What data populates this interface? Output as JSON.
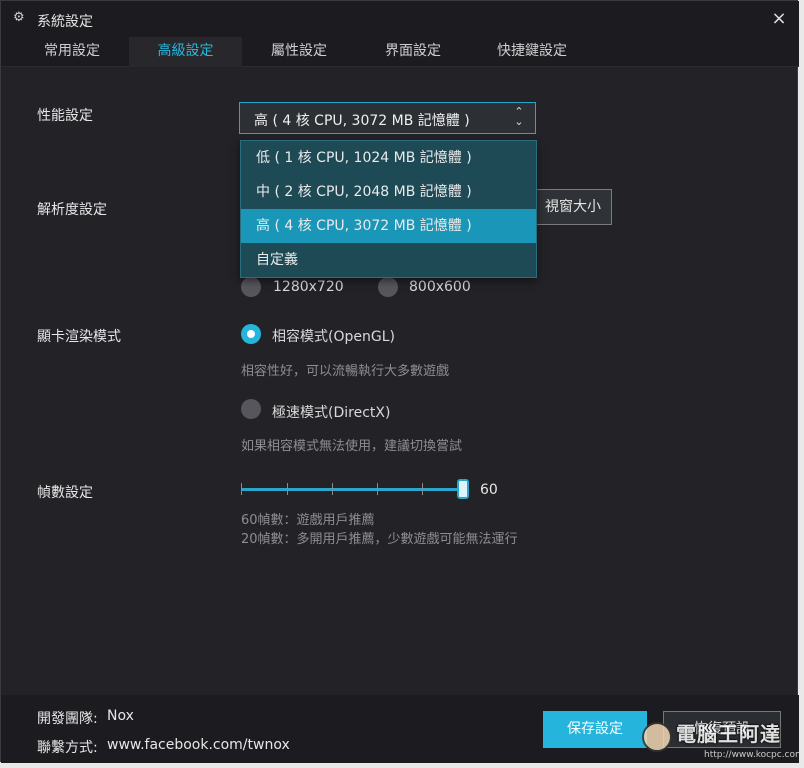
{
  "window": {
    "title": "系統設定",
    "close_glyph": "×",
    "settings_icon": "gear-icon"
  },
  "tabs": [
    {
      "label": "常用設定",
      "active": false
    },
    {
      "label": "高級設定",
      "active": true
    },
    {
      "label": "屬性設定",
      "active": false
    },
    {
      "label": "界面設定",
      "active": false
    },
    {
      "label": "快捷鍵設定",
      "active": false
    }
  ],
  "performance": {
    "label": "性能設定",
    "selected": "高 ( 4 核 CPU, 3072 MB 記憶體 )",
    "options": [
      "低 ( 1 核 CPU, 1024 MB 記憶體 )",
      "中 ( 2 核 CPU, 2048 MB 記憶體 )",
      "高 ( 4 核 CPU, 3072 MB 記憶體 )",
      "自定義"
    ]
  },
  "resolution": {
    "label": "解析度設定",
    "window_size_button": "視窗大小",
    "options": [
      "1280x720",
      "800x600"
    ]
  },
  "graphics": {
    "label": "顯卡渲染模式",
    "compat_label": "相容模式(OpenGL)",
    "compat_desc": "相容性好，可以流暢執行大多數遊戲",
    "speed_label": "極速模式(DirectX)",
    "speed_desc": "如果相容模式無法使用，建議切換嘗試",
    "selected": "compat"
  },
  "fps": {
    "label": "幀數設定",
    "value": "60",
    "note1": "60幀數：遊戲用戶推薦",
    "note2": "20幀數：多開用戶推薦，少數遊戲可能無法運行"
  },
  "footer": {
    "dev_label": "開發團隊:",
    "dev_value": "Nox",
    "contact_label": "聯繫方式:",
    "contact_value": "www.facebook.com/twnox",
    "save_button": "保存設定",
    "restore_button": "恢復預設"
  },
  "watermark": {
    "text": "電腦王阿達",
    "url": "http://www.kocpc.com.tw"
  }
}
